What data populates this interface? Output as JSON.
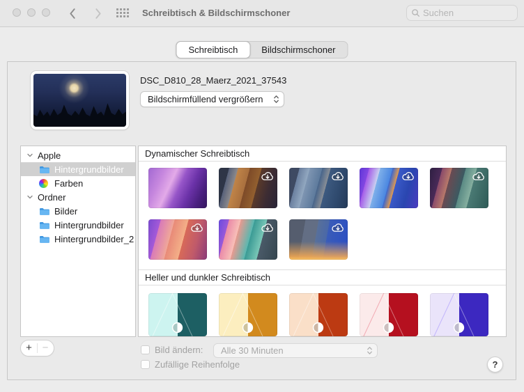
{
  "window": {
    "title": "Schreibtisch & Bildschirmschoner"
  },
  "titlebar": {
    "search_placeholder": "Suchen"
  },
  "tabs": [
    {
      "label": "Schreibtisch",
      "selected": true
    },
    {
      "label": "Bildschirmschoner",
      "selected": false
    }
  ],
  "preview": {
    "filename": "DSC_D810_28_Maerz_2021_37543",
    "fill_mode": "Bildschirmfüllend vergrößern"
  },
  "sidebar": {
    "items": [
      {
        "type": "group",
        "label": "Apple"
      },
      {
        "type": "folder",
        "label": "Hintergrundbilder",
        "selected": true
      },
      {
        "type": "colors",
        "label": "Farben"
      },
      {
        "type": "group",
        "label": "Ordner"
      },
      {
        "type": "folder",
        "label": "Bilder"
      },
      {
        "type": "folder",
        "label": "Hintergrundbilder"
      },
      {
        "type": "folder",
        "label": "Hintergrundbilder_2"
      }
    ]
  },
  "gallery": {
    "sections": [
      {
        "title": "Dynamischer Schreibtisch",
        "rows": [
          [
            {
              "name": "monterey",
              "cloud": false,
              "bg": "linear-gradient(115deg,#a268d2 0%,#c687de 22%,#e3aae8 38%,#9655c8 52%,#6b32a8 68%,#4a2080 84%,#35175e 100%)"
            },
            {
              "name": "big-sur-cliffs",
              "cloud": true,
              "bg": "linear-gradient(105deg,#2e3547 0%,#2e3547 15%,#566079 15%,#8c8a8c 28%,#c08448 28%,#a86f3e 45%,#7d4a28 45%,#93602f 62%,#5a3a2a 62%,#3c2c33 80%,#282436 100%)"
            },
            {
              "name": "catalina",
              "cloud": true,
              "bg": "linear-gradient(105deg,#3e4a63 0%,#3e4a63 15%,#6a7f9f 15%,#93a9c1 30%,#7e95b2 30%,#5d7a9c 48%,#47648a 48%,#8a8f96 60%,#3d5a80 60%,#2f4a6e 80%,#243a58 100%)"
            },
            {
              "name": "big-sur-graphic",
              "cloud": true,
              "bg": "linear-gradient(105deg,#5f35d8 0%,#8348e2 14%,#a55ae8 14%,#c9d2f0 30%,#7fb0ea 30%,#4a86e0 48%,#3a66d0 48%,#e09a50 58%,#3a5ac8 58%,#2a46b0 78%,#4a3ac0 100%)"
            },
            {
              "name": "peninsula",
              "cloud": true,
              "bg": "linear-gradient(105deg,#2e1f42 0%,#4a2a58 18%,#8a4a6a 18%,#b87a6a 32%,#6a4a52 32%,#3a5a62 52%,#5a8a84 52%,#86b0a0 68%,#4a7a74 68%,#2e5a56 100%)"
            }
          ],
          [
            {
              "name": "desert",
              "cloud": true,
              "bg": "linear-gradient(105deg,#7a4ad0 0%,#a55ad8 18%,#d87ab8 18%,#f0a898 38%,#e88a78 38%,#f4b088 58%,#d86a58 58%,#c05a6a 78%,#8a3a78 100%)"
            },
            {
              "name": "beach",
              "cloud": true,
              "bg": "linear-gradient(105deg,#6a4ae0 0%,#9a5ad8 15%,#ea8aa8 15%,#f8c0b8 32%,#e89a90 32%,#58b8b0 52%,#3a9a94 52%,#7ac8b8 70%,#4a5a68 70%,#35464f 100%)"
            },
            {
              "name": "solar-gradients",
              "cloud": true,
              "bg": "linear-gradient(180deg,rgba(248,170,80,0) 55%,rgba(248,170,80,.85) 92%,#f8c060 100%),linear-gradient(100deg,#555d6e 0%,#555d6e 25%,#636e84 25%,#636e84 45%,#58709a 45%,#4a68a8 62%,#3a5cb8 62%,#2a4ec4 100%)"
            }
          ]
        ]
      },
      {
        "title": "Heller und dunkler Schreibtisch",
        "rows": [
          [
            {
              "name": "hello-teal",
              "toggle": true,
              "bg": "linear-gradient(115deg,transparent 30%,rgba(255,255,255,.6) 30.8%,transparent 31.6%),linear-gradient(65deg,transparent 55%,rgba(255,255,255,.5) 55.8%,transparent 56.6%),linear-gradient(90deg,#cdf4f0 50%,#1d5f63 50%)"
            },
            {
              "name": "hello-yellow",
              "toggle": true,
              "bg": "linear-gradient(115deg,transparent 30%,rgba(255,255,255,.6) 30.8%,transparent 31.6%),linear-gradient(65deg,transparent 55%,rgba(255,255,255,.5) 55.8%,transparent 56.6%),linear-gradient(90deg,#fceebf 50%,#d28a1e 50%)"
            },
            {
              "name": "hello-orange-red",
              "toggle": true,
              "bg": "linear-gradient(115deg,transparent 30%,rgba(255,255,255,.55) 30.8%,transparent 31.6%),linear-gradient(65deg,transparent 55%,rgba(255,255,255,.45) 55.8%,transparent 56.6%),linear-gradient(90deg,#fadfc8 50%,#bc3a12 50%)"
            },
            {
              "name": "hello-pink-red",
              "toggle": true,
              "bg": "linear-gradient(115deg,transparent 30%,rgba(230,90,110,.55) 30.8%,transparent 31.6%),linear-gradient(65deg,transparent 55%,rgba(255,255,255,.5) 55.8%,transparent 56.6%),linear-gradient(90deg,#fbeaea 50%,#b5101f 50%)"
            },
            {
              "name": "hello-purple",
              "toggle": true,
              "bg": "linear-gradient(115deg,transparent 30%,rgba(150,130,255,.6) 30.8%,transparent 31.6%),linear-gradient(65deg,transparent 55%,rgba(255,255,255,.5) 55.8%,transparent 56.6%),linear-gradient(90deg,#eae4fa 50%,#3c28c0 50%)"
            }
          ]
        ]
      }
    ]
  },
  "footer": {
    "add_label": "+",
    "remove_label": "−",
    "change_picture_label": "Bild ändern:",
    "interval_value": "Alle 30 Minuten",
    "random_order_label": "Zufällige Reihenfolge",
    "help_label": "?"
  },
  "colors": {
    "folder_blue": "#3d95e0",
    "folder_blue_light": "#67b6f2",
    "selection_bg": "#d0d0d0",
    "window_bg": "#ececec"
  },
  "icons": {
    "traffic_lights": "three gray circles (window unfocused)",
    "back": "chevron-left",
    "forward": "chevron-right",
    "show_all": "grid of 12 dots",
    "search": "magnifier",
    "cloud": "cloud with down arrow",
    "light_dark": "half-filled circle"
  }
}
